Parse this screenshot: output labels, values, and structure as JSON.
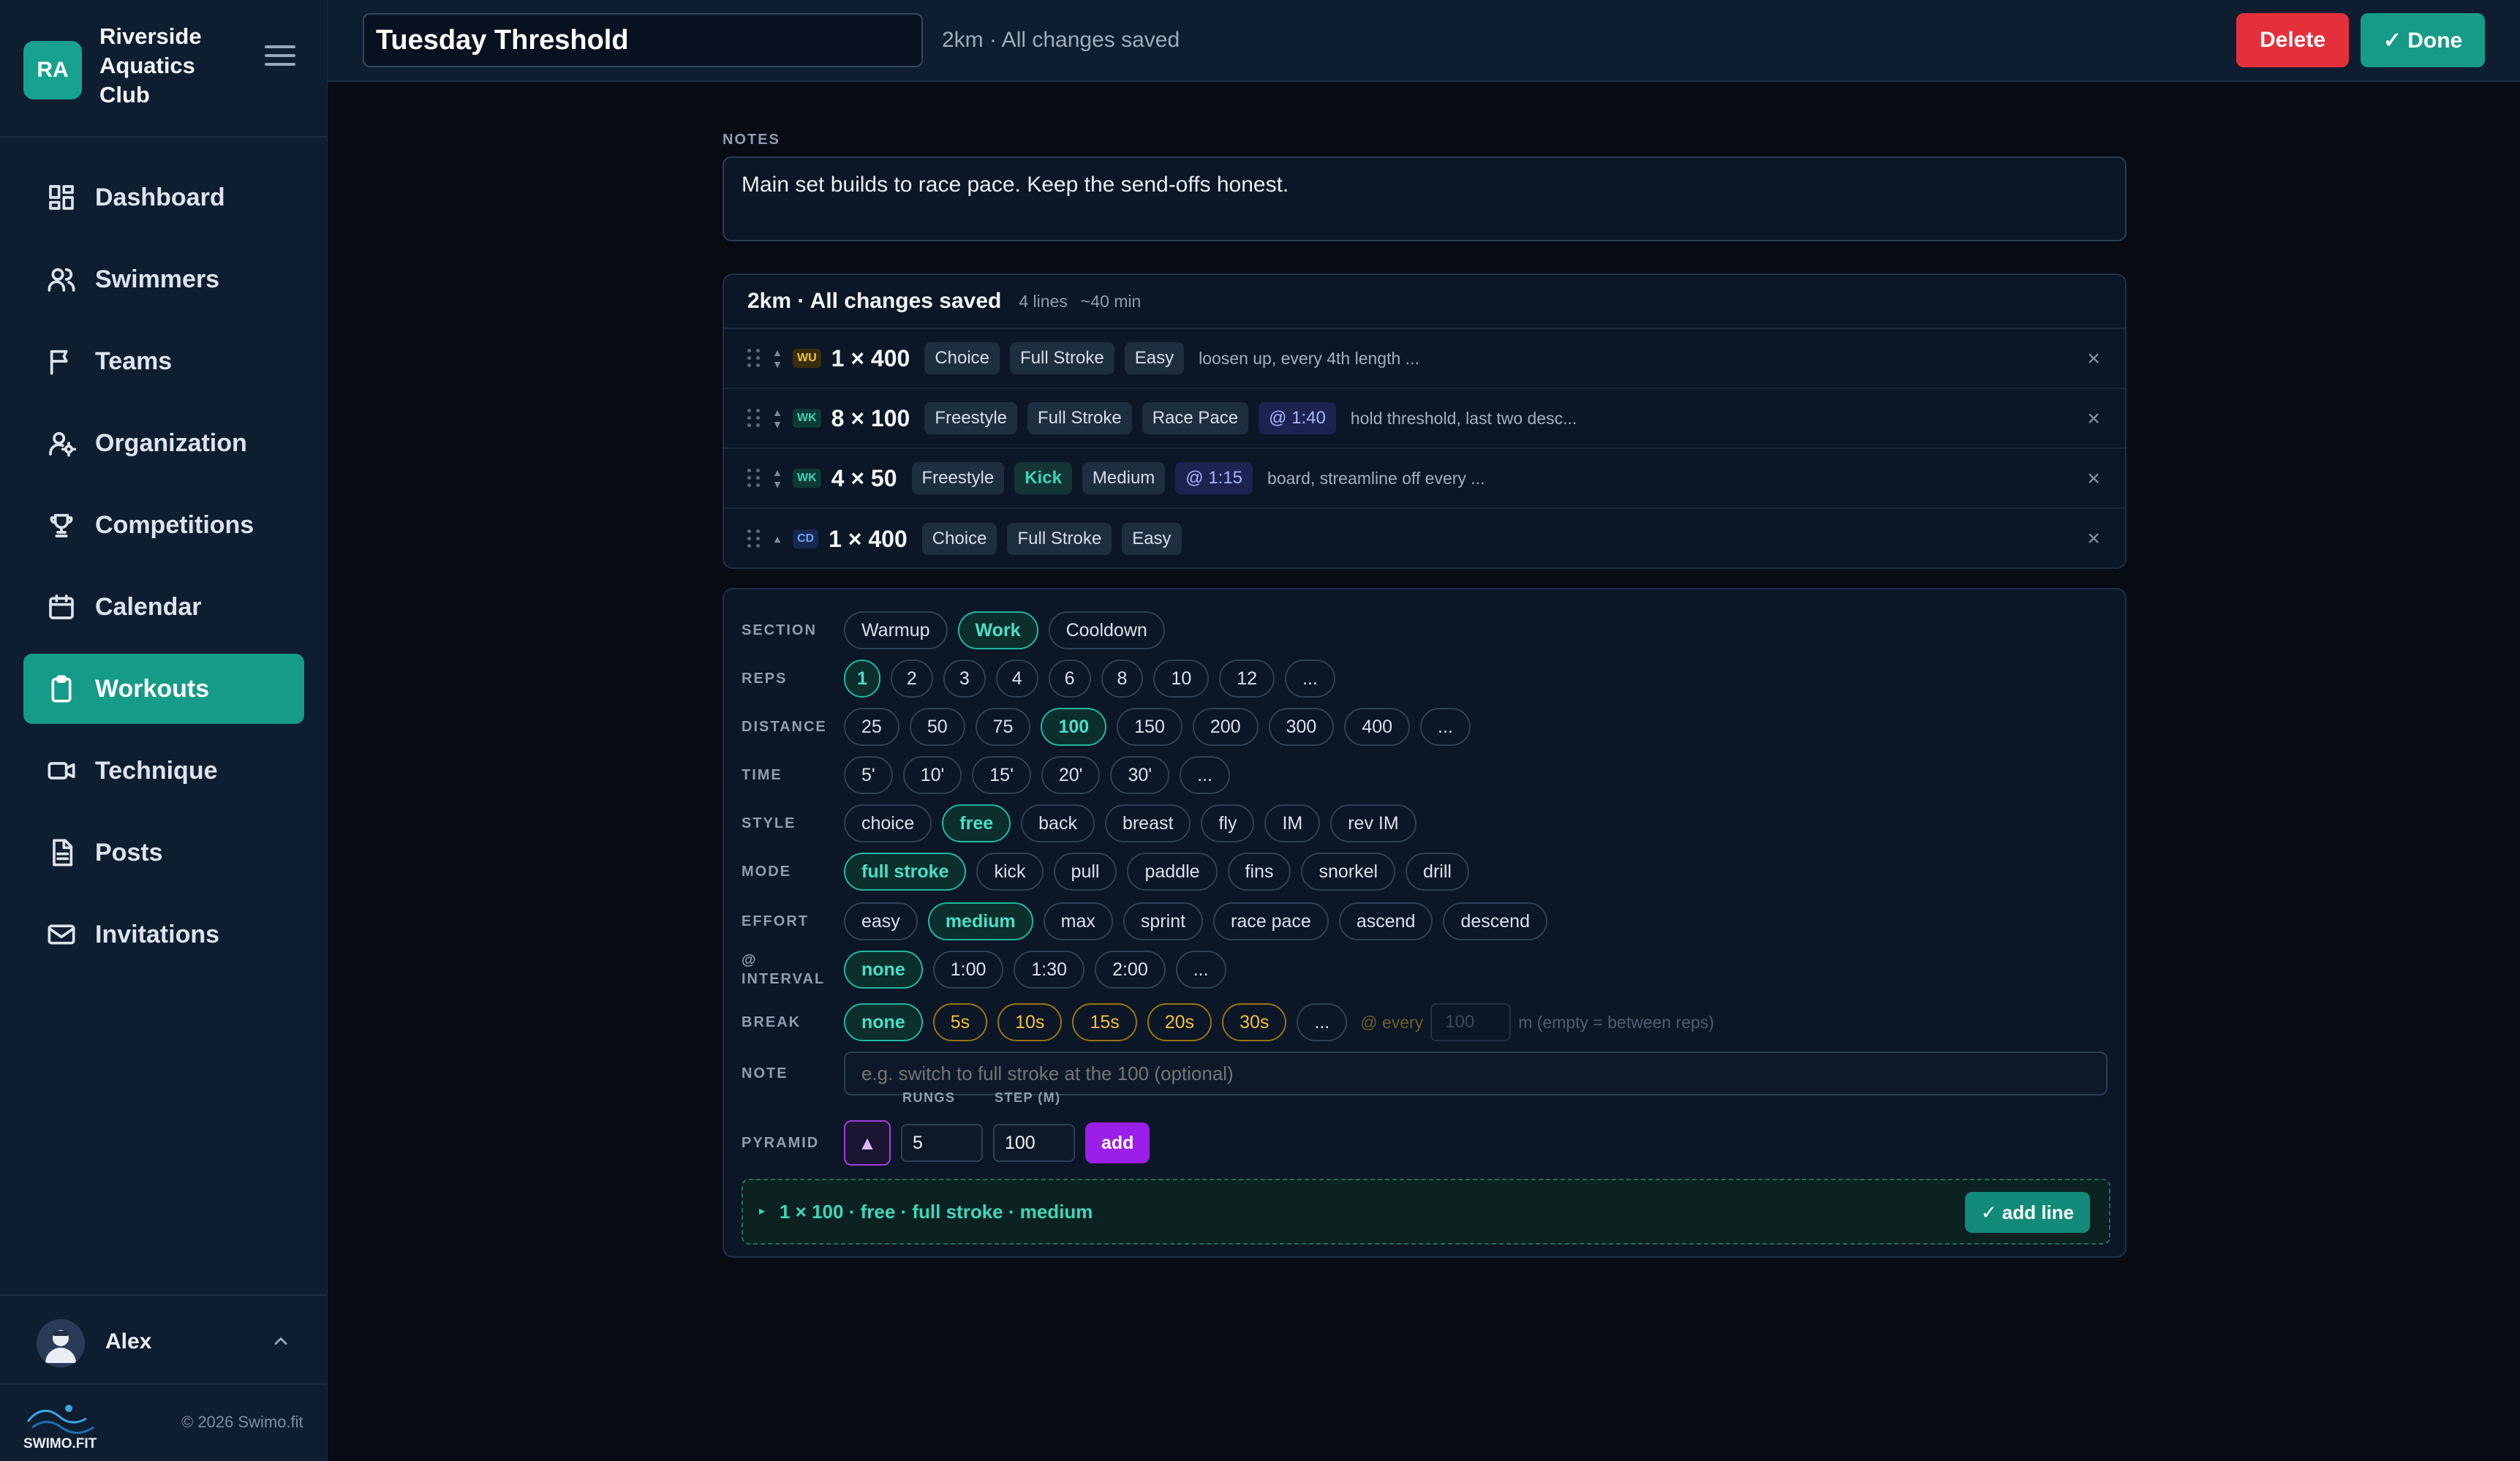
{
  "brand": {
    "initials": "RA",
    "name": "Riverside Aquatics Club"
  },
  "nav": [
    {
      "label": "Dashboard",
      "icon": "dashboard-icon"
    },
    {
      "label": "Swimmers",
      "icon": "users-icon"
    },
    {
      "label": "Teams",
      "icon": "flag-icon"
    },
    {
      "label": "Organization",
      "icon": "user-cog-icon"
    },
    {
      "label": "Competitions",
      "icon": "trophy-icon"
    },
    {
      "label": "Calendar",
      "icon": "calendar-icon"
    },
    {
      "label": "Workouts",
      "icon": "clipboard-icon",
      "active": true
    },
    {
      "label": "Technique",
      "icon": "video-icon"
    },
    {
      "label": "Posts",
      "icon": "document-icon"
    },
    {
      "label": "Invitations",
      "icon": "mail-icon"
    }
  ],
  "user": {
    "name": "Alex"
  },
  "footer": {
    "logo_text": "SWIMO.FIT",
    "copyright": "© 2026 Swimo.fit"
  },
  "topbar": {
    "title": "Tuesday Threshold",
    "status": "2km · All changes saved",
    "delete_label": "Delete",
    "done_label": "✓ Done"
  },
  "notes": {
    "label": "NOTES",
    "text": "Main set builds to race pace. Keep the send-offs honest."
  },
  "summary": {
    "title": "2km · All changes saved",
    "lines": "4 lines",
    "duration": "~40 min"
  },
  "lines": [
    {
      "section": "WU",
      "reps": "1 × 400",
      "tags": [
        "Choice",
        "Full Stroke",
        "Easy"
      ],
      "interval": "",
      "note": "loosen up, every 4th length ..."
    },
    {
      "section": "WK",
      "reps": "8 × 100",
      "tags": [
        "Freestyle",
        "Full Stroke",
        "Race Pace"
      ],
      "interval": "@ 1:40",
      "note": "hold threshold, last two desc..."
    },
    {
      "section": "WK",
      "reps": "4 × 50",
      "tags": [
        "Freestyle",
        "Kick",
        "Medium"
      ],
      "interval": "@ 1:15",
      "note": "board, streamline off every ..."
    },
    {
      "section": "CD",
      "reps": "1 × 400",
      "tags": [
        "Choice",
        "Full Stroke",
        "Easy"
      ],
      "interval": "",
      "note": ""
    }
  ],
  "builder": {
    "section": {
      "label": "SECTION",
      "options": [
        "Warmup",
        "Work",
        "Cooldown"
      ],
      "selected": "Work"
    },
    "reps": {
      "label": "REPS",
      "options": [
        "1",
        "2",
        "3",
        "4",
        "6",
        "8",
        "10",
        "12",
        "..."
      ],
      "selected": "1"
    },
    "distance": {
      "label": "DISTANCE",
      "options": [
        "25",
        "50",
        "75",
        "100",
        "150",
        "200",
        "300",
        "400",
        "..."
      ],
      "selected": "100"
    },
    "time": {
      "label": "TIME",
      "options": [
        "5'",
        "10'",
        "15'",
        "20'",
        "30'",
        "..."
      ],
      "selected": ""
    },
    "style": {
      "label": "STYLE",
      "options": [
        "choice",
        "free",
        "back",
        "breast",
        "fly",
        "IM",
        "rev IM"
      ],
      "selected": "free"
    },
    "mode": {
      "label": "MODE",
      "options": [
        "full stroke",
        "kick",
        "pull",
        "paddle",
        "fins",
        "snorkel",
        "drill"
      ],
      "selected": "full stroke"
    },
    "effort": {
      "label": "EFFORT",
      "options": [
        "easy",
        "medium",
        "max",
        "sprint",
        "race pace",
        "ascend",
        "descend"
      ],
      "selected": "medium"
    },
    "interval": {
      "label": "@ INTERVAL",
      "options": [
        "none",
        "1:00",
        "1:30",
        "2:00",
        "..."
      ],
      "selected": "none"
    },
    "break": {
      "label": "BREAK",
      "options": [
        "none",
        "5s",
        "10s",
        "15s",
        "20s",
        "30s",
        "..."
      ],
      "selected": "none",
      "every_label": "@ every",
      "every_placeholder": "100",
      "hint": "m (empty = between reps)"
    },
    "note": {
      "label": "NOTE",
      "placeholder": "e.g. switch to full stroke at the 100 (optional)"
    },
    "pyramid": {
      "label": "PYRAMID",
      "rungs_label": "RUNGS",
      "rungs": "5",
      "step_label": "STEP (M)",
      "step": "100",
      "add_label": "add"
    },
    "preview": {
      "text": "1 × 100 · free · full stroke · medium",
      "add_line_label": "✓ add line"
    }
  },
  "colors": {
    "accent": "#159b88",
    "danger": "#e5303c",
    "pyramid": "#9b1fe8",
    "warn": "#f5c33b"
  }
}
